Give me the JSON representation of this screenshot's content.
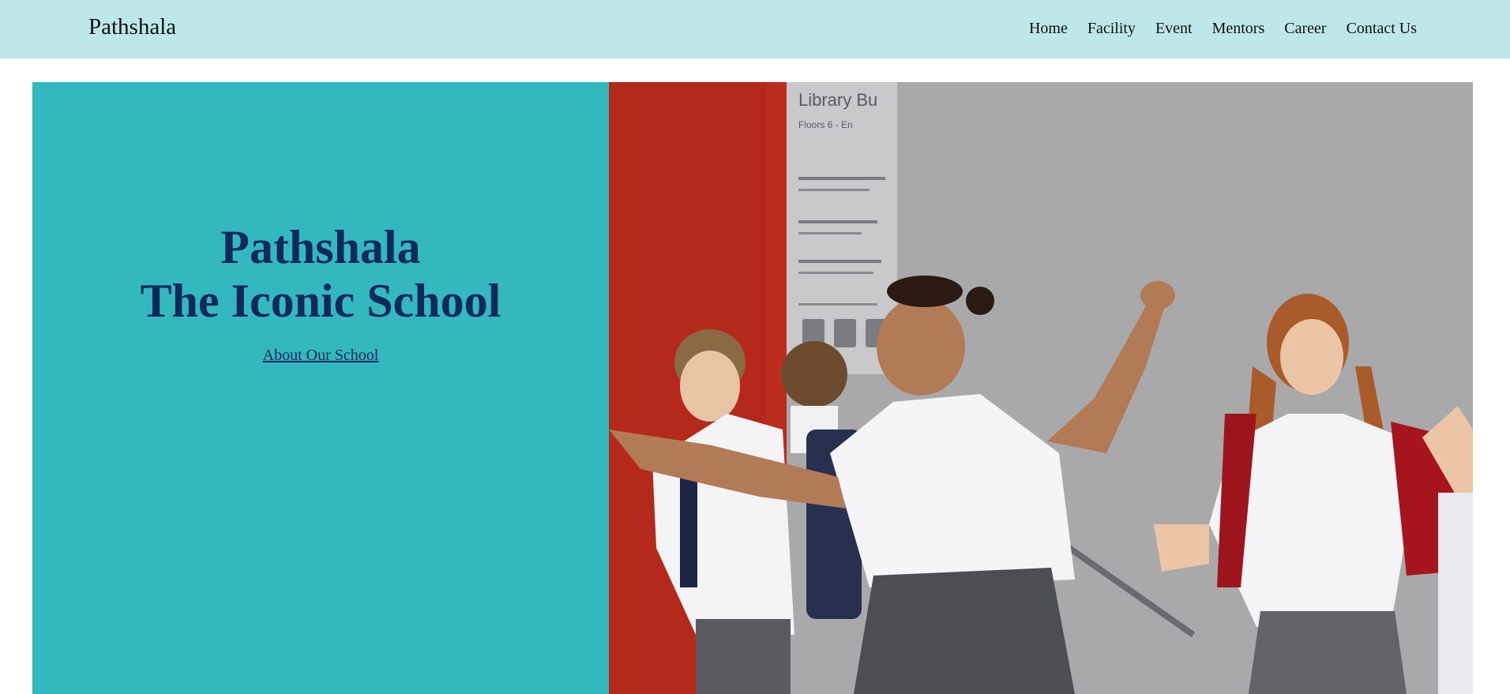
{
  "brand": {
    "name": "Pathshala"
  },
  "nav": {
    "items": [
      {
        "label": "Home"
      },
      {
        "label": "Facility"
      },
      {
        "label": "Event"
      },
      {
        "label": "Mentors"
      },
      {
        "label": "Career"
      },
      {
        "label": "Contact Us"
      }
    ]
  },
  "hero": {
    "title_line1": "Pathshala",
    "title_line2": "The Iconic School",
    "link_label": "About Our School",
    "photo_sign_line1": "Library Bu",
    "photo_sign_line2": "Floors 6 - En"
  },
  "colors": {
    "nav_bg": "#bde7e8",
    "hero_bg": "#34b8bf",
    "title_color": "#0f2a5a",
    "wall_red": "#b5281c",
    "wall_grey": "#a9a8ab"
  }
}
